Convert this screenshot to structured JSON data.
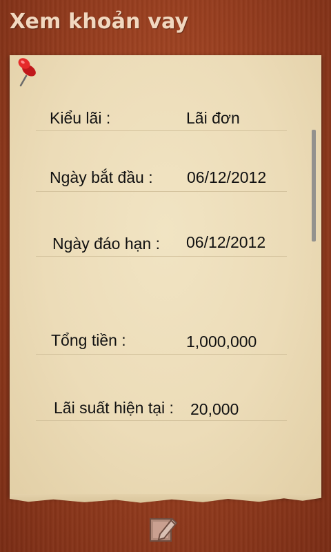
{
  "header": {
    "title": "Xem khoản vay"
  },
  "loan": {
    "rows": [
      {
        "label": "Kiểu lãi :",
        "value": "Lãi đơn"
      },
      {
        "label": "Ngày bắt đầu :",
        "value": "06/12/2012"
      },
      {
        "label": "Ngày đáo hạn :",
        "value": "06/12/2012"
      },
      {
        "label": "Tổng tiền :",
        "value": "1,000,000"
      },
      {
        "label": "Lãi suất hiện tại :",
        "value": "20,000"
      }
    ]
  },
  "app_bar": {
    "edit_icon": "edit-icon"
  },
  "colors": {
    "wood": "#9a3f1f",
    "paper": "#ecdcb8",
    "title": "#f1d8c0"
  }
}
